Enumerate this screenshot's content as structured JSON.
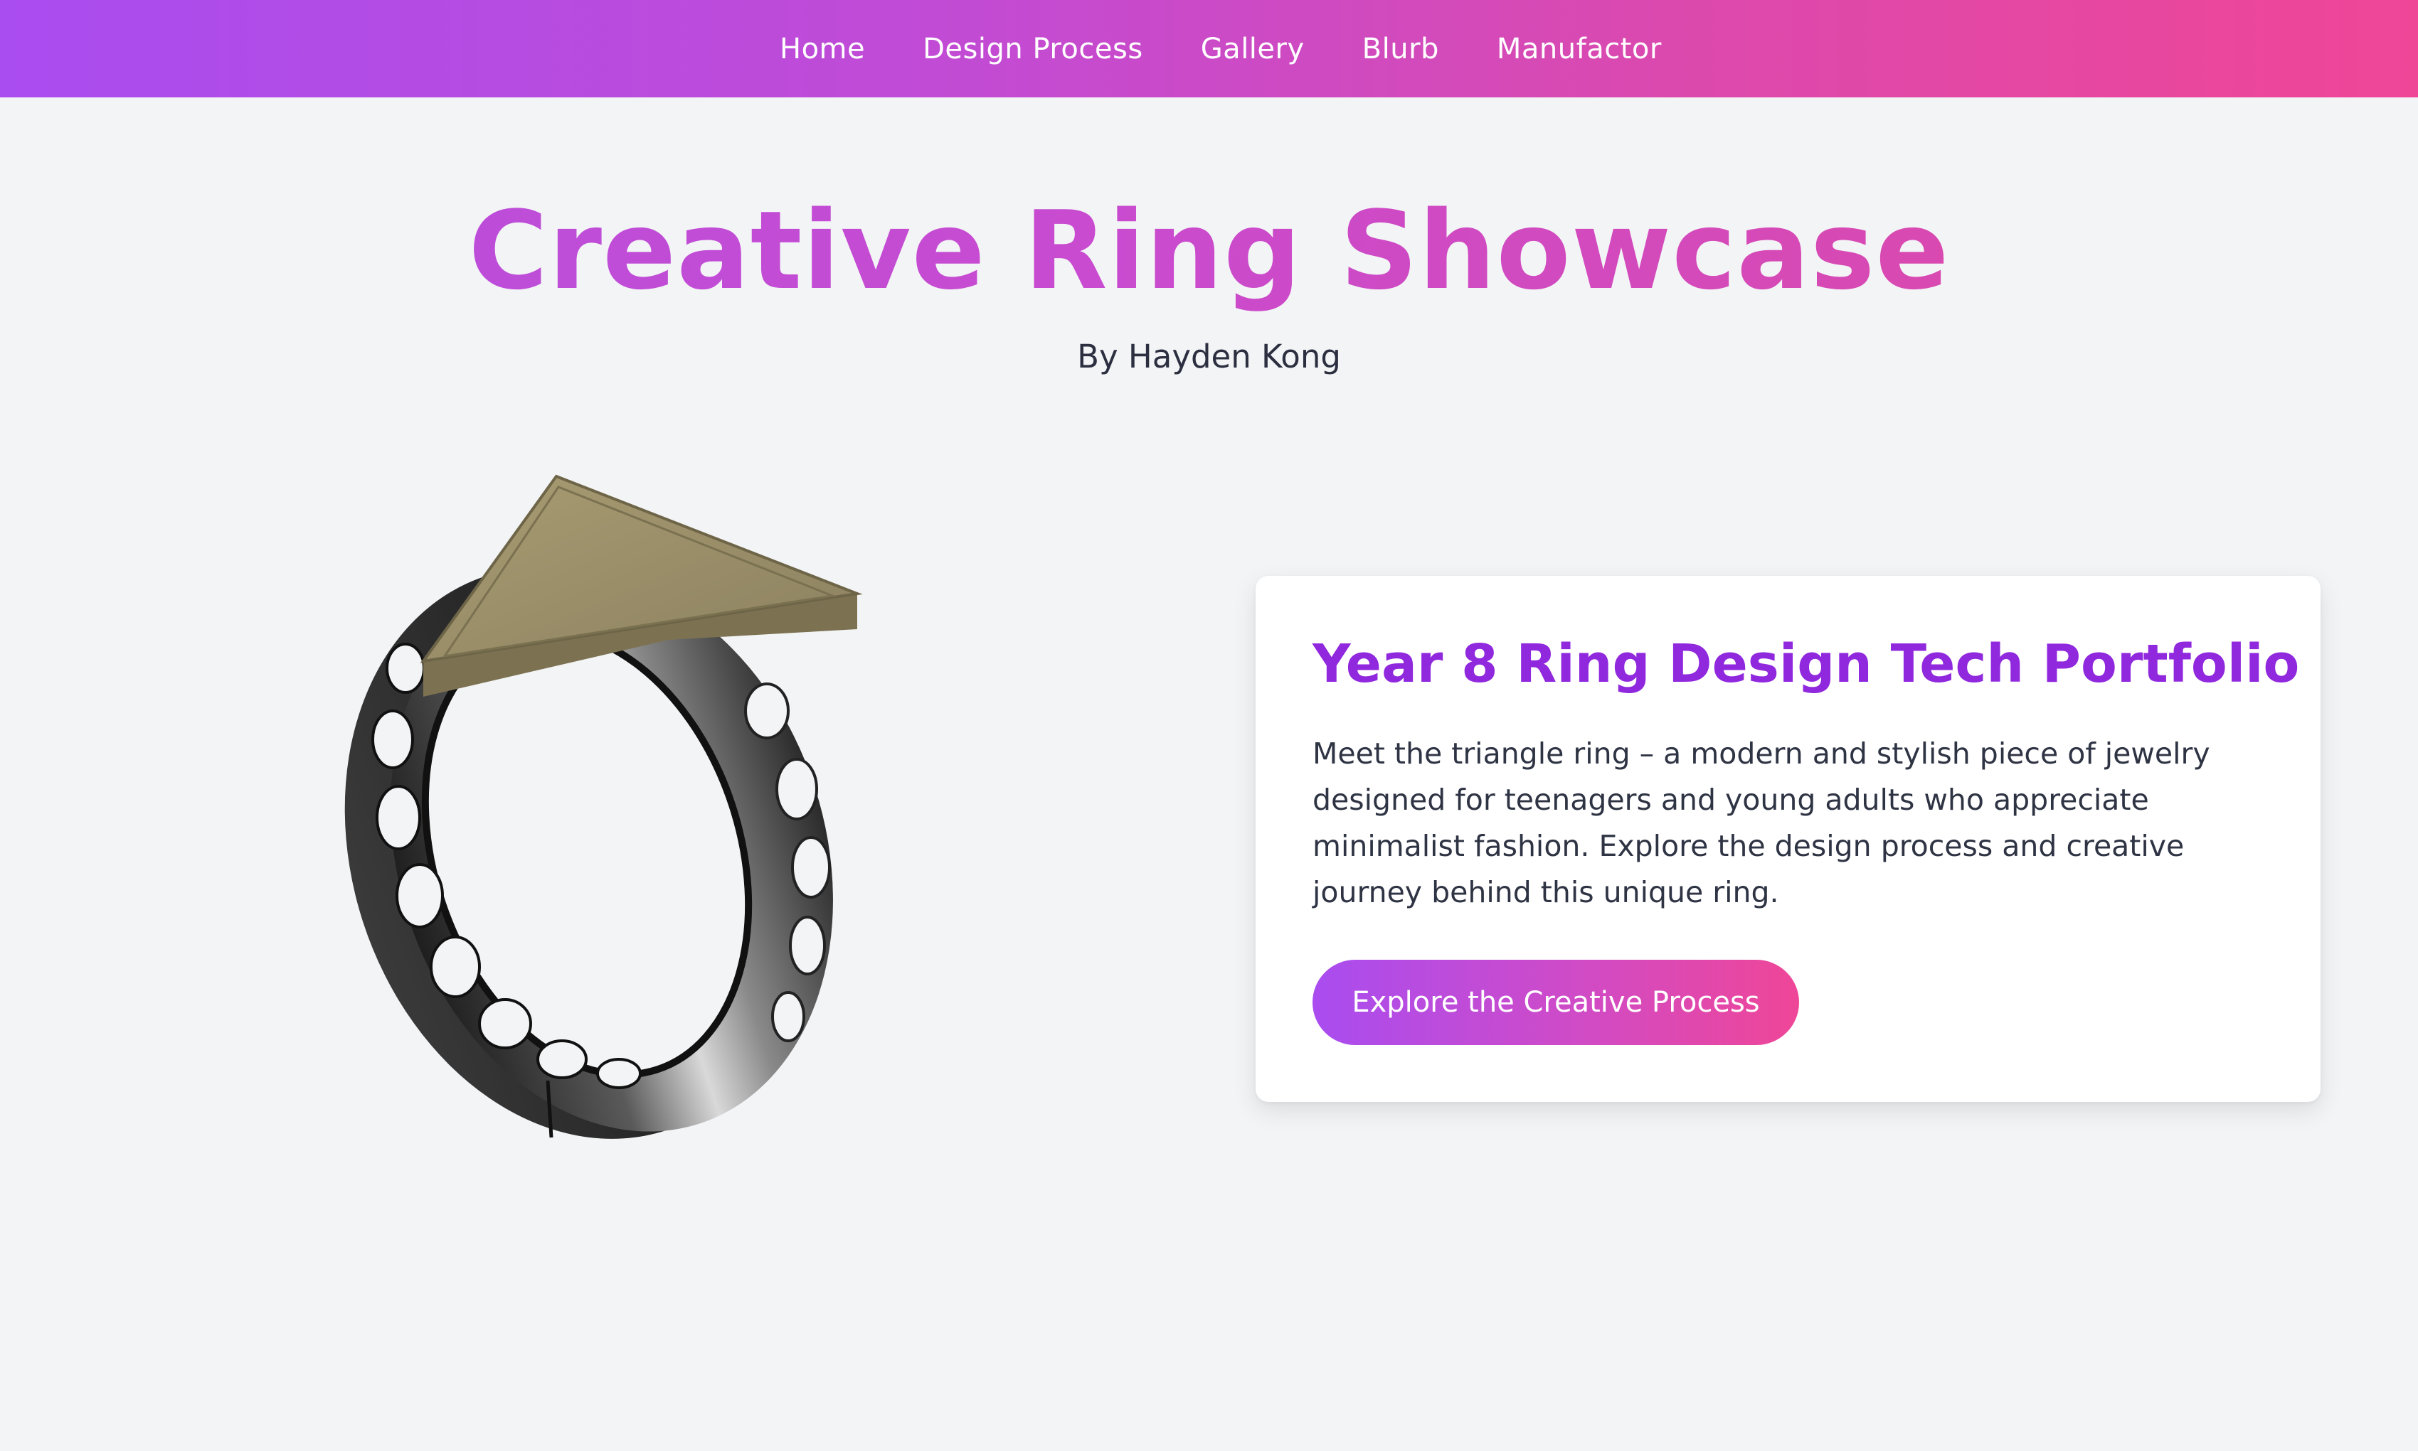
{
  "nav": {
    "items": [
      {
        "label": "Home"
      },
      {
        "label": "Design Process"
      },
      {
        "label": "Gallery"
      },
      {
        "label": "Blurb"
      },
      {
        "label": "Manufactor"
      }
    ]
  },
  "hero": {
    "title": "Creative Ring Showcase",
    "byline": "By Hayden Kong"
  },
  "ring_image": {
    "icon": "triangle-ring-image"
  },
  "card": {
    "title": "Year 8 Ring Design Tech Portfolio",
    "text": "Meet the triangle ring – a modern and stylish piece of jewelry designed for teenagers and young adults who appreciate minimalist fashion. Explore the design process and creative journey behind this unique ring.",
    "button_label": "Explore the Creative Process"
  },
  "colors": {
    "nav_gradient_start": "#a94cf0",
    "nav_gradient_end": "#ef4697",
    "title_purple": "#9028de",
    "page_background": "#f3f4f6",
    "ring_band": "#2e2e2e",
    "ring_triangle_gold": "#9c9068"
  }
}
